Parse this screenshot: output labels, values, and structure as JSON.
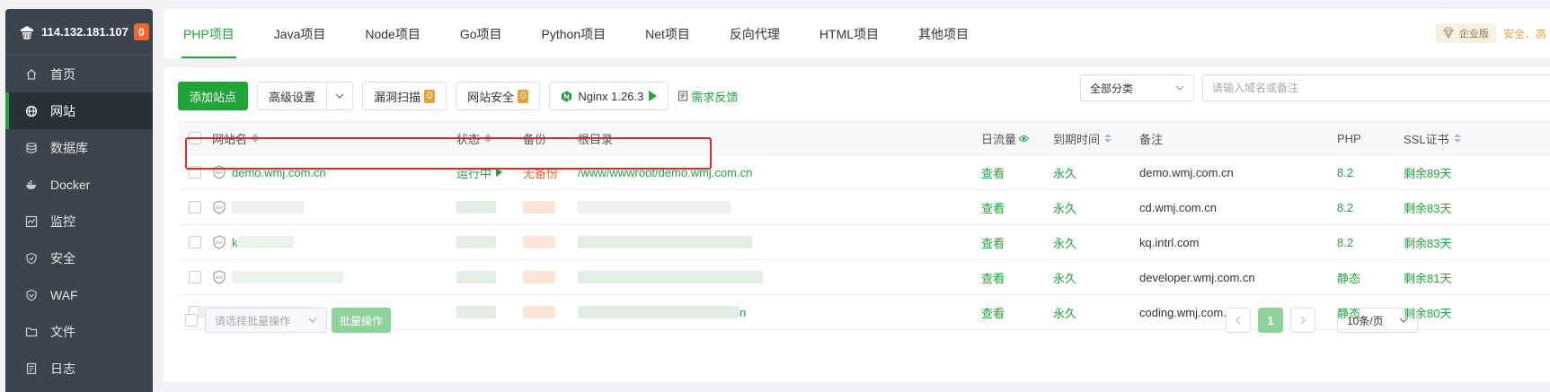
{
  "sidebar": {
    "ip": "114.132.181.107",
    "badge": "0",
    "items": [
      {
        "label": "首页",
        "icon": "home-icon"
      },
      {
        "label": "网站",
        "icon": "globe-icon",
        "active": true
      },
      {
        "label": "数据库",
        "icon": "database-icon"
      },
      {
        "label": "Docker",
        "icon": "docker-icon"
      },
      {
        "label": "监控",
        "icon": "monitor-icon"
      },
      {
        "label": "安全",
        "icon": "shield-icon"
      },
      {
        "label": "WAF",
        "icon": "waf-shield-icon"
      },
      {
        "label": "文件",
        "icon": "folder-icon"
      },
      {
        "label": "日志",
        "icon": "log-icon"
      }
    ]
  },
  "tabs": [
    "PHP项目",
    "Java项目",
    "Node项目",
    "Go项目",
    "Python项目",
    "Net项目",
    "反向代理",
    "HTML项目",
    "其他项目"
  ],
  "enterprise": {
    "label": "企业版",
    "link": "安全、高"
  },
  "toolbar": {
    "add_site": "添加站点",
    "advanced": "高级设置",
    "vuln_scan": "漏洞扫描",
    "vuln_count": "0",
    "site_security": "网站安全",
    "security_count": "0",
    "nginx": "Nginx 1.26.3",
    "feedback": "需求反馈",
    "category": "全部分类",
    "search_placeholder": "请输入域名或备注"
  },
  "table": {
    "headers": {
      "name": "网站名",
      "status": "状态",
      "backup": "备份",
      "root": "根目录",
      "flow": "日流量",
      "expire": "到期时间",
      "note": "备注",
      "php": "PHP",
      "ssl": "SSL证书"
    },
    "rows": [
      {
        "name": "demo.wmj.com.cn",
        "status": "运行中",
        "backup": "无备份",
        "root": "/www/wwwroot/demo.wmj.com.cn",
        "flow": "查看",
        "expire": "永久",
        "note": "demo.wmj.com.cn",
        "php": "8.2",
        "ssl": "剩余89天"
      },
      {
        "name": "",
        "status": "",
        "backup": "",
        "root": "",
        "flow": "查看",
        "expire": "永久",
        "note": "cd.wmj.com.cn",
        "php": "8.2",
        "ssl": "剩余83天"
      },
      {
        "name": "k",
        "status": "",
        "backup": "",
        "root": "",
        "flow": "查看",
        "expire": "永久",
        "note": "kq.intrl.com",
        "php": "8.2",
        "ssl": "剩余83天"
      },
      {
        "name": "",
        "status": "",
        "backup": "",
        "root": "",
        "flow": "查看",
        "expire": "永久",
        "note": "developer.wmj.com.cn",
        "php": "静态",
        "ssl": "剩余81天"
      },
      {
        "name": "",
        "status": "",
        "backup": "",
        "root": "n",
        "flow": "查看",
        "expire": "永久",
        "note": "coding.wmj.com.cn",
        "php": "静态",
        "ssl": "剩余80天"
      }
    ]
  },
  "footer": {
    "batch_placeholder": "请选择批量操作",
    "batch_button": "批量操作",
    "current_page": "1",
    "per_page": "10条/页"
  }
}
